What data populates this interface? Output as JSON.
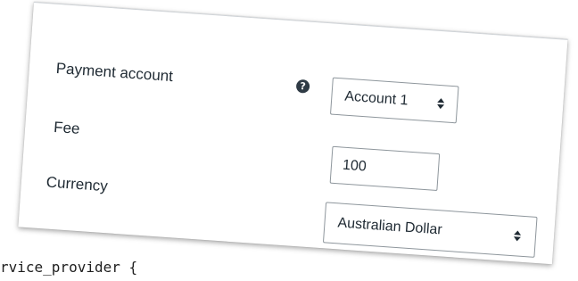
{
  "form": {
    "payment_account": {
      "label": "Payment account",
      "selected": "Account 1",
      "help_icon": "question-circle-icon"
    },
    "fee": {
      "label": "Fee",
      "value": "100"
    },
    "currency": {
      "label": "Currency",
      "selected": "Australian Dollar"
    }
  },
  "code": {
    "line": "rvice_provider {"
  },
  "colors": {
    "text": "#1f2a33",
    "control_border": "#8e969c",
    "help_icon_bg": "#2f3b45"
  }
}
